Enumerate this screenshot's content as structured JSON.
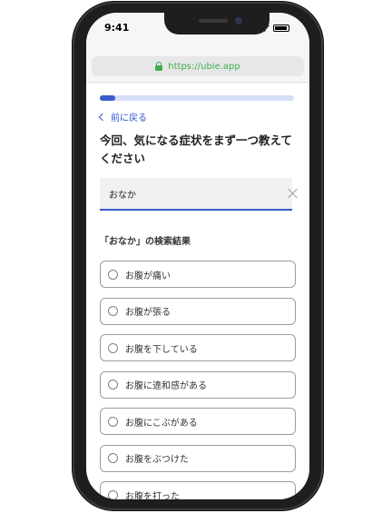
{
  "status_bar": {
    "time": "9:41"
  },
  "browser": {
    "url": "https://ubie.app"
  },
  "progress": {
    "fraction": 0.08
  },
  "nav": {
    "back_label": "前に戻る"
  },
  "question": {
    "text": "今回、気になる症状をまず一つ教えてください"
  },
  "search": {
    "value": "おなか"
  },
  "results": {
    "heading": "「おなか」の検索結果",
    "options": [
      {
        "label": "お腹が痛い"
      },
      {
        "label": "お腹が張る"
      },
      {
        "label": "お腹を下している"
      },
      {
        "label": "お腹に違和感がある"
      },
      {
        "label": "お腹にこぶがある"
      },
      {
        "label": "お腹をぶつけた"
      },
      {
        "label": "お腹を打った"
      }
    ]
  },
  "colors": {
    "accent": "#3b5cc9",
    "url_green": "#3fae4a",
    "frame": "#1e1e1e"
  },
  "icons": [
    "lock-icon",
    "chevron-left-icon",
    "clear-icon",
    "radio-icon",
    "signal-icon",
    "wifi-icon",
    "battery-icon"
  ]
}
